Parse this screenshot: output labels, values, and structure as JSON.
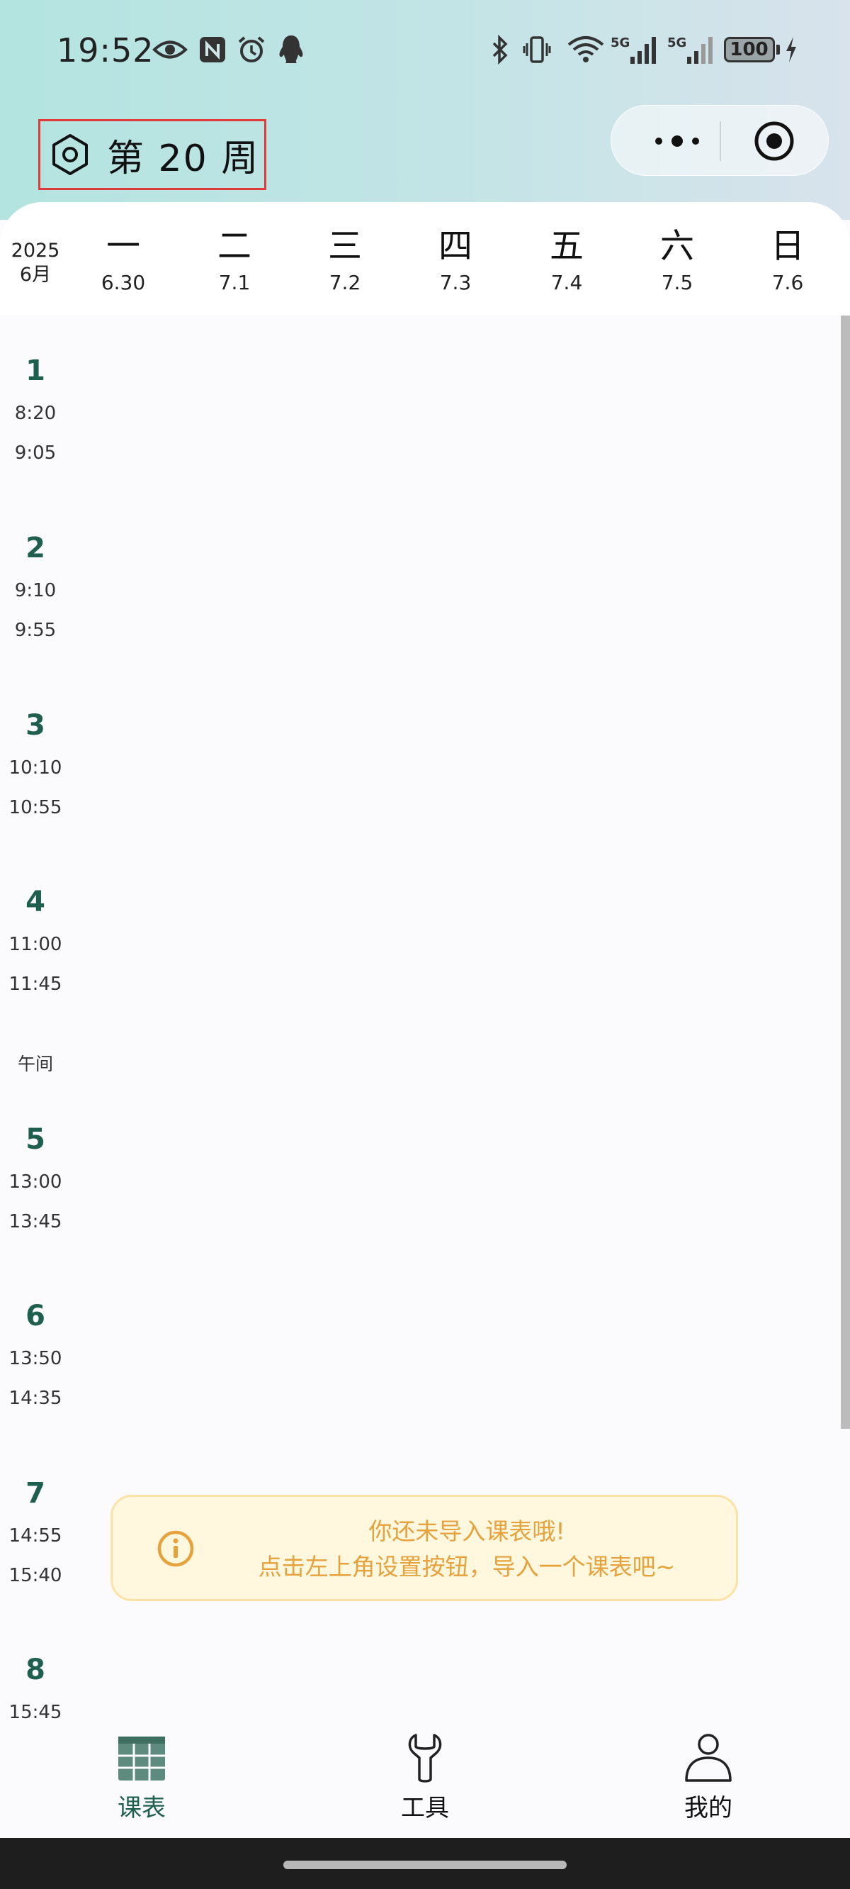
{
  "status_bar": {
    "time": "19:52",
    "battery": "100",
    "left_icons": [
      "eye-icon",
      "nfc-icon",
      "alarm-icon",
      "qq-penguin-icon"
    ],
    "right_icons": [
      "bluetooth-icon",
      "vibrate-icon",
      "wifi-icon",
      "signal-5g-icon",
      "signal-5g-icon",
      "battery-icon",
      "charging-icon"
    ],
    "signal_label": "5G"
  },
  "header": {
    "week_label": "第 20 周",
    "settings_icon": "hexagon-gear-icon",
    "menu_icon": "more-dots-icon",
    "close_icon": "target-circle-icon"
  },
  "day_header": {
    "year": "2025",
    "month": "6月",
    "days": [
      {
        "name": "一",
        "date": "6.30"
      },
      {
        "name": "二",
        "date": "7.1"
      },
      {
        "name": "三",
        "date": "7.2"
      },
      {
        "name": "四",
        "date": "7.3"
      },
      {
        "name": "五",
        "date": "7.4"
      },
      {
        "name": "六",
        "date": "7.5"
      },
      {
        "name": "日",
        "date": "7.6"
      }
    ]
  },
  "periods": [
    {
      "num": "1",
      "start": "8:20",
      "end": "9:05"
    },
    {
      "num": "2",
      "start": "9:10",
      "end": "9:55"
    },
    {
      "num": "3",
      "start": "10:10",
      "end": "10:55"
    },
    {
      "num": "4",
      "start": "11:00",
      "end": "11:45"
    },
    {
      "num": "5",
      "start": "13:00",
      "end": "13:45"
    },
    {
      "num": "6",
      "start": "13:50",
      "end": "14:35"
    },
    {
      "num": "7",
      "start": "14:55",
      "end": "15:40"
    },
    {
      "num": "8",
      "start": "15:45",
      "end": ""
    }
  ],
  "noon_label": "午间",
  "notice": {
    "line1": "你还未导入课表哦!",
    "line2": "点击左上角设置按钮，导入一个课表吧~",
    "icon": "info-circle-icon"
  },
  "tabs": [
    {
      "label": "课表",
      "icon": "timetable-grid-icon",
      "active": true
    },
    {
      "label": "工具",
      "icon": "wrench-icon",
      "active": false
    },
    {
      "label": "我的",
      "icon": "user-icon",
      "active": false
    }
  ],
  "colors": {
    "accent": "#1f5f4f",
    "notice_text": "#e6a23c",
    "notice_bg": "#fff7de",
    "header_gradient_start": "#b3e4e0",
    "header_gradient_end": "#d8e3ec",
    "highlight_border": "#e03b3b"
  }
}
